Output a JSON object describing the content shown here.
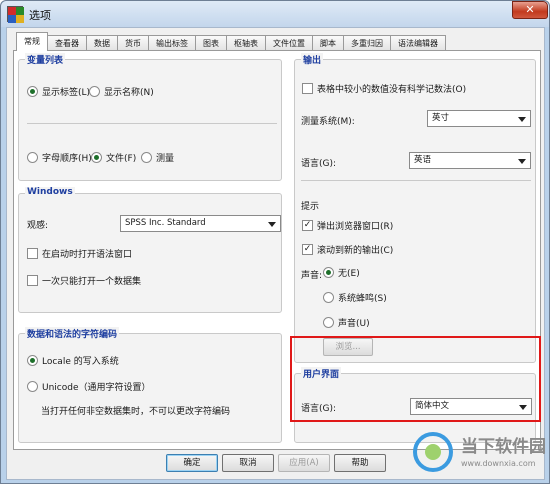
{
  "window": {
    "title": "选项",
    "close": "✕"
  },
  "tabs": [
    "常规",
    "查看器",
    "数据",
    "货币",
    "输出标签",
    "图表",
    "枢轴表",
    "文件位置",
    "脚本",
    "多重归因",
    "语法编辑器"
  ],
  "variable_list": {
    "title": "变量列表",
    "display_options": [
      "显示标签(L)",
      "显示名称(N)"
    ],
    "order_options": [
      "字母顺序(H)",
      "文件(F)",
      "测量"
    ]
  },
  "windows_group": {
    "title": "Windows",
    "look_label": "观感:",
    "look_value": "SPSS Inc. Standard",
    "checks": [
      "在启动时打开语法窗口",
      "一次只能打开一个数据集"
    ]
  },
  "encoding": {
    "title": "数据和语法的字符编码",
    "options": [
      "Locale 的写入系统",
      "Unicode（通用字符设置）"
    ],
    "note": "当打开任何非空数据集时，不可以更改字符编码"
  },
  "output": {
    "title": "输出",
    "scientific_check": "表格中较小的数值没有科学记数法(O)",
    "measurement_label": "测量系统(M):",
    "measurement_value": "英寸",
    "language_label": "语言(G):",
    "language_value": "英语",
    "notify_label": "提示",
    "notify_checks": [
      "弹出浏览器窗口(R)",
      "滚动到新的输出(C)"
    ],
    "sound_label": "声音:",
    "sound_options": [
      "无(E)",
      "系统蜂鸣(S)",
      "声音(U)"
    ],
    "browse": "浏览..."
  },
  "ui_group": {
    "title": "用户界面",
    "language_label": "语言(G):",
    "language_value": "简体中文"
  },
  "buttons": {
    "ok": "确定",
    "cancel": "取消",
    "apply": "应用(A)",
    "help": "帮助"
  },
  "watermark": {
    "name": "当下软件园",
    "url": "www.downxia.com"
  },
  "colors": {
    "accent": "#1f3fa0",
    "highlight": "#e01818"
  }
}
